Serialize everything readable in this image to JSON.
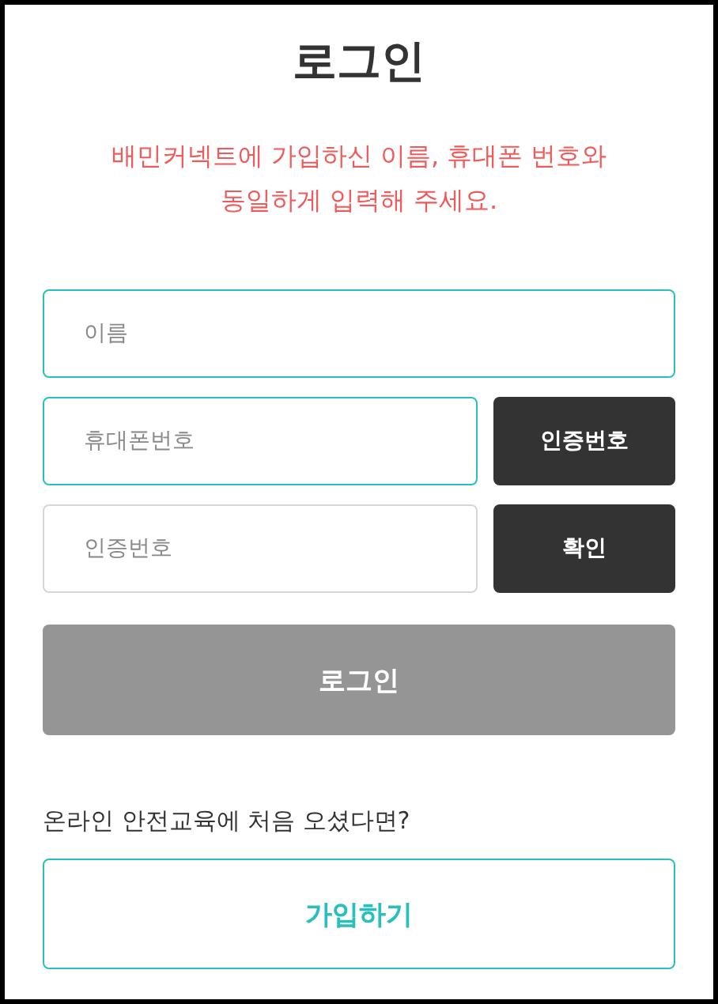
{
  "title": "로그인",
  "notice": "배민커넥트에 가입하신 이름, 휴대폰 번호와 동일하게 입력해 주세요.",
  "fields": [
    {
      "placeholder": "이름",
      "highlighted": true
    },
    {
      "placeholder": "휴대폰번호",
      "highlighted": true,
      "button": "인증번호"
    },
    {
      "placeholder": "인증번호",
      "highlighted": false,
      "button": "확인"
    }
  ],
  "login_button": {
    "label": "로그인",
    "disabled": true
  },
  "signup_prompt": "온라인 안전교육에 처음 오셨다면?",
  "signup_button": {
    "label": "가입하기"
  }
}
